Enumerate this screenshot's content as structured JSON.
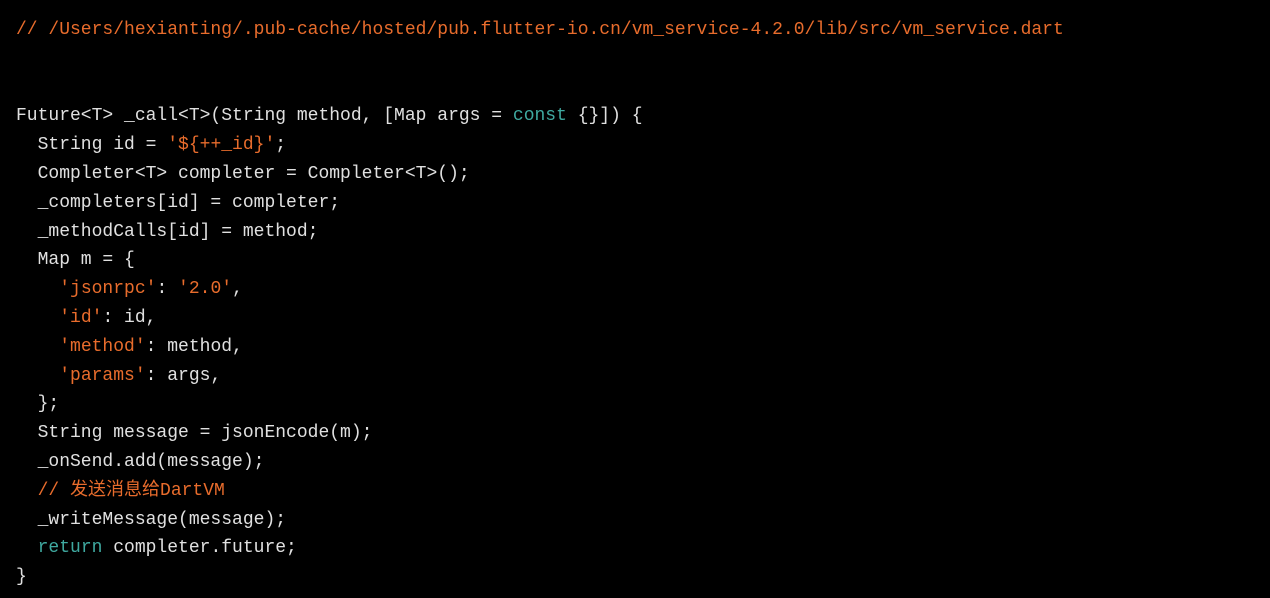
{
  "code": {
    "line1_comment": "// /Users/hexianting/.pub-cache/hosted/pub.flutter-io.cn/vm_service-4.2.0/lib/src/vm_service.dart",
    "line3_a": "Future<T> _call<T>(String method, [Map args = ",
    "line3_const": "const",
    "line3_b": " {}]) {",
    "line4_a": "  String id = ",
    "line4_str": "'${++_id}'",
    "line4_b": ";",
    "line5": "  Completer<T> completer = Completer<T>();",
    "line6": "  _completers[id] = completer;",
    "line7": "  _methodCalls[id] = method;",
    "line8": "  Map m = {",
    "line9_ind": "    ",
    "line9_k": "'jsonrpc'",
    "line9_m": ": ",
    "line9_v": "'2.0'",
    "line9_e": ",",
    "line10_ind": "    ",
    "line10_k": "'id'",
    "line10_e": ": id,",
    "line11_ind": "    ",
    "line11_k": "'method'",
    "line11_e": ": method,",
    "line12_ind": "    ",
    "line12_k": "'params'",
    "line12_e": ": args,",
    "line13": "  };",
    "line14": "  String message = jsonEncode(m);",
    "line15": "  _onSend.add(message);",
    "line16_ind": "  ",
    "line16_comment": "// 发送消息给DartVM",
    "line17": "  _writeMessage(message);",
    "line18_ind": "  ",
    "line18_return": "return",
    "line18_b": " completer.future;",
    "line19": "}"
  }
}
